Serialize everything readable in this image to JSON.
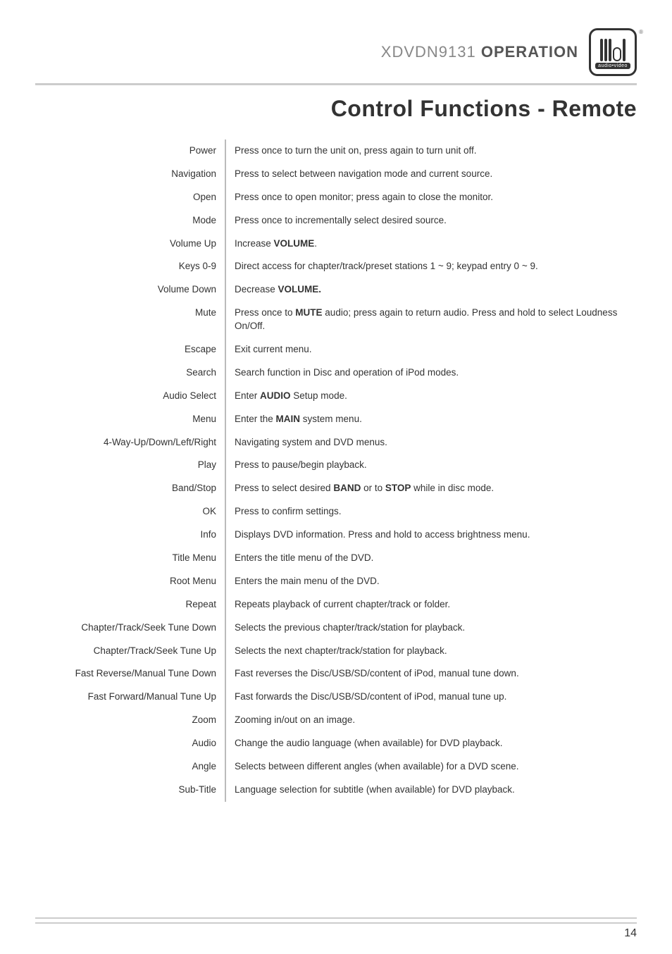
{
  "header": {
    "model": "XDVDN9131",
    "operation": "OPERATION",
    "logo_sub": "audio•video",
    "logo_r": "®"
  },
  "title": "Control Functions - Remote",
  "rows": [
    {
      "label": "Power",
      "desc": "Press once to turn the unit on, press again to turn unit off."
    },
    {
      "label": "Navigation",
      "desc": "Press to select between navigation mode and current source."
    },
    {
      "label": "Open",
      "desc": "Press once to open monitor; press again to close the monitor."
    },
    {
      "label": "Mode",
      "desc": "Press once to incrementally select desired source."
    },
    {
      "label": "Volume Up",
      "desc_html": "Increase <b>VOLUME</b>."
    },
    {
      "label": "Keys 0-9",
      "desc": "Direct access for chapter/track/preset stations 1 ~ 9; keypad entry 0 ~ 9."
    },
    {
      "label": "Volume Down",
      "desc_html": "Decrease <b>VOLUME.</b>"
    },
    {
      "label": "Mute",
      "desc_html": "Press once to <b>MUTE</b> audio; press again to return audio. Press and hold to select Loudness On/Off."
    },
    {
      "label": "Escape",
      "desc": "Exit current menu."
    },
    {
      "label": "Search",
      "desc": "Search function in Disc and operation of iPod modes."
    },
    {
      "label": "Audio Select",
      "desc_html": "Enter <b>AUDIO</b> Setup mode."
    },
    {
      "label": "Menu",
      "desc_html": "Enter the <b>MAIN</b> system menu."
    },
    {
      "label": "4-Way-Up/Down/Left/Right",
      "desc": "Navigating system and DVD menus."
    },
    {
      "label": "Play",
      "desc": "Press to pause/begin playback."
    },
    {
      "label": "Band/Stop",
      "desc_html": "Press to select desired <b>BAND</b> or to <b>STOP</b> while in disc mode."
    },
    {
      "label": "OK",
      "desc": "Press to confirm settings."
    },
    {
      "label": "Info",
      "desc": "Displays DVD information. Press and hold to access brightness menu."
    },
    {
      "label": "Title Menu",
      "desc": "Enters the title menu of the DVD."
    },
    {
      "label": "Root Menu",
      "desc": "Enters the main menu of the DVD."
    },
    {
      "label": "Repeat",
      "desc": "Repeats playback of current chapter/track or folder."
    },
    {
      "label": "Chapter/Track/Seek Tune Down",
      "desc": "Selects the previous chapter/track/station for playback."
    },
    {
      "label": "Chapter/Track/Seek Tune Up",
      "desc": "Selects the next chapter/track/station for playback."
    },
    {
      "label": "Fast Reverse/Manual Tune Down",
      "desc": "Fast reverses the Disc/USB/SD/content of iPod, manual tune down."
    },
    {
      "label": "Fast Forward/Manual Tune Up",
      "desc": "Fast forwards the Disc/USB/SD/content of iPod, manual tune up."
    },
    {
      "label": "Zoom",
      "desc": "Zooming in/out on an image."
    },
    {
      "label": "Audio",
      "desc": "Change the audio language (when available) for DVD playback."
    },
    {
      "label": "Angle",
      "desc": "Selects between different angles (when available) for a DVD scene."
    },
    {
      "label": "Sub-Title",
      "desc": "Language selection for subtitle (when available) for DVD playback."
    }
  ],
  "page_number": "14"
}
